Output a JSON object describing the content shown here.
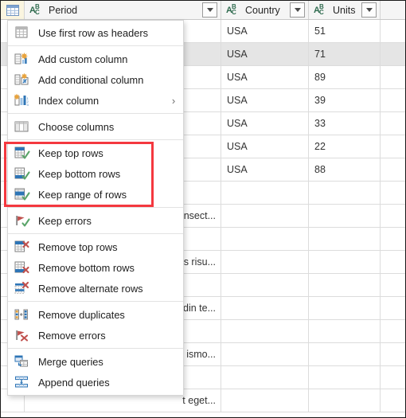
{
  "app": {
    "context": "power-query-table-transform-menu"
  },
  "grid": {
    "corner_icon": "table-icon",
    "columns": [
      {
        "name": "period",
        "label": "Period",
        "type_icon": "abc-type-icon",
        "dropdown_icon": "chevron-down-icon"
      },
      {
        "name": "country",
        "label": "Country",
        "type_icon": "abc-type-icon",
        "dropdown_icon": "chevron-down-icon"
      },
      {
        "name": "units",
        "label": "Units",
        "type_icon": "abc-type-icon",
        "dropdown_icon": "chevron-down-icon"
      }
    ],
    "rows": [
      {
        "period": "",
        "country": "USA",
        "units": "51",
        "selected": false
      },
      {
        "period": "",
        "country": "USA",
        "units": "71",
        "selected": true
      },
      {
        "period": "",
        "country": "USA",
        "units": "89",
        "selected": false
      },
      {
        "period": "",
        "country": "USA",
        "units": "39",
        "selected": false
      },
      {
        "period": "",
        "country": "USA",
        "units": "33",
        "selected": false
      },
      {
        "period": "",
        "country": "USA",
        "units": "22",
        "selected": false
      },
      {
        "period": "",
        "country": "USA",
        "units": "88",
        "selected": false
      },
      {
        "period": "",
        "country": "",
        "units": "",
        "selected": false
      },
      {
        "period": "onsect...",
        "country": "",
        "units": "",
        "selected": false
      },
      {
        "period": "",
        "country": "",
        "units": "",
        "selected": false
      },
      {
        "period": "us risu...",
        "country": "",
        "units": "",
        "selected": false
      },
      {
        "period": "",
        "country": "",
        "units": "",
        "selected": false
      },
      {
        "period": "din te...",
        "country": "",
        "units": "",
        "selected": false
      },
      {
        "period": "",
        "country": "",
        "units": "",
        "selected": false
      },
      {
        "period": "ismo...",
        "country": "",
        "units": "",
        "selected": false
      },
      {
        "period": "",
        "country": "",
        "units": "",
        "selected": false
      },
      {
        "period": "t eget...",
        "country": "",
        "units": "",
        "selected": false
      }
    ]
  },
  "menu": {
    "items": [
      {
        "id": "use-first-row-as-headers",
        "label": "Use first row as headers",
        "icon": "table-header-icon",
        "submenu": false,
        "separator_after": true
      },
      {
        "id": "add-custom-column",
        "label": "Add custom column",
        "icon": "add-custom-column-icon",
        "submenu": false,
        "separator_after": false
      },
      {
        "id": "add-conditional-column",
        "label": "Add conditional column",
        "icon": "add-conditional-column-icon",
        "submenu": false,
        "separator_after": false
      },
      {
        "id": "index-column",
        "label": "Index column",
        "icon": "index-column-icon",
        "submenu": true,
        "separator_after": true
      },
      {
        "id": "choose-columns",
        "label": "Choose columns",
        "icon": "choose-columns-icon",
        "submenu": false,
        "separator_after": true
      },
      {
        "id": "keep-top-rows",
        "label": "Keep top rows",
        "icon": "keep-top-rows-icon",
        "submenu": false,
        "separator_after": false
      },
      {
        "id": "keep-bottom-rows",
        "label": "Keep bottom rows",
        "icon": "keep-bottom-rows-icon",
        "submenu": false,
        "separator_after": false
      },
      {
        "id": "keep-range-of-rows",
        "label": "Keep range of rows",
        "icon": "keep-range-of-rows-icon",
        "submenu": false,
        "separator_after": true
      },
      {
        "id": "keep-errors",
        "label": "Keep errors",
        "icon": "keep-errors-icon",
        "submenu": false,
        "separator_after": true
      },
      {
        "id": "remove-top-rows",
        "label": "Remove top rows",
        "icon": "remove-top-rows-icon",
        "submenu": false,
        "separator_after": false
      },
      {
        "id": "remove-bottom-rows",
        "label": "Remove bottom rows",
        "icon": "remove-bottom-rows-icon",
        "submenu": false,
        "separator_after": false
      },
      {
        "id": "remove-alternate-rows",
        "label": "Remove alternate rows",
        "icon": "remove-alternate-rows-icon",
        "submenu": false,
        "separator_after": true
      },
      {
        "id": "remove-duplicates",
        "label": "Remove duplicates",
        "icon": "remove-duplicates-icon",
        "submenu": false,
        "separator_after": false
      },
      {
        "id": "remove-errors",
        "label": "Remove errors",
        "icon": "remove-errors-icon",
        "submenu": false,
        "separator_after": true
      },
      {
        "id": "merge-queries",
        "label": "Merge queries",
        "icon": "merge-queries-icon",
        "submenu": false,
        "separator_after": false
      },
      {
        "id": "append-queries",
        "label": "Append queries",
        "icon": "append-queries-icon",
        "submenu": false,
        "separator_after": false
      }
    ],
    "submenu_glyph": "›"
  },
  "annotation": {
    "highlight_color": "#f4383f",
    "highlight_target": "keep-rows-group"
  }
}
